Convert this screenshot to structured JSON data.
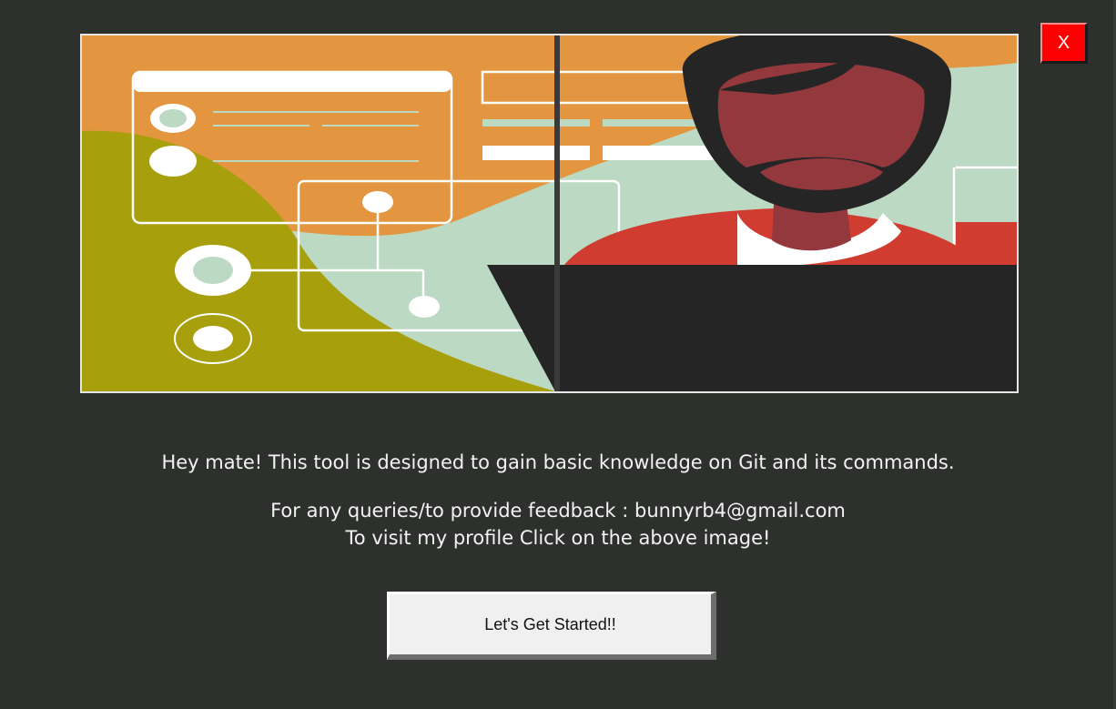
{
  "close_button": {
    "label": "X"
  },
  "banner": {
    "illustration": "developer-at-laptop-illustration"
  },
  "info": {
    "line1": "Hey mate! This tool is designed to gain basic knowledge on Git and its commands.",
    "line2": "For any queries/to provide feedback : bunnyrb4@gmail.com",
    "line3": "To visit my profile Click on the above image!"
  },
  "start_button": {
    "label": "Let's Get Started!!"
  },
  "colors": {
    "background": "#2e302e",
    "close": "#ff0000",
    "orange": "#e3963f",
    "olive": "#a89f0c",
    "mint": "#bcd9c4",
    "skin": "#93383d",
    "shirt": "#d13c30",
    "dark": "#252525"
  }
}
